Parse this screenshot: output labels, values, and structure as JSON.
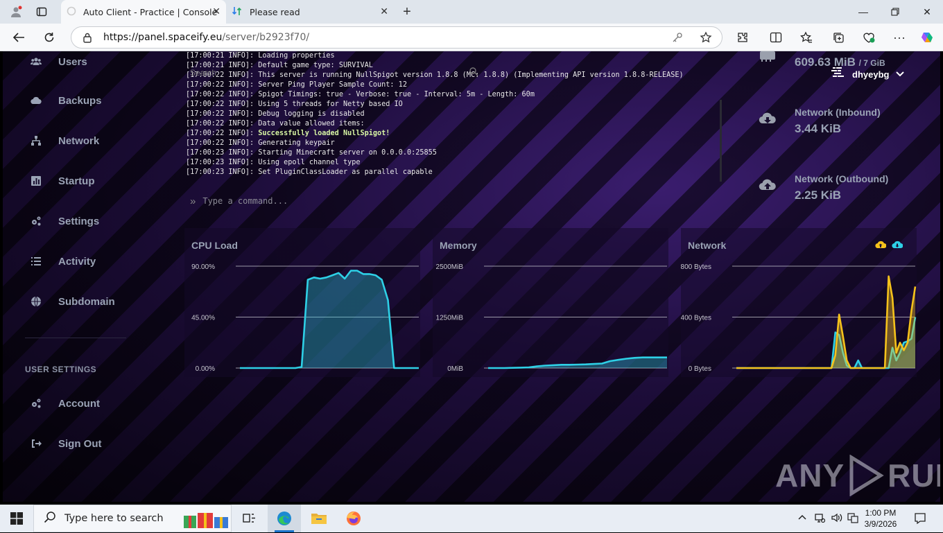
{
  "browser": {
    "tabs": [
      {
        "title": "Auto Client - Practice | Console",
        "active": true
      },
      {
        "title": "Please read",
        "active": false
      }
    ],
    "url_host": "https://panel.spaceify.eu",
    "url_path": "/server/b2923f70/"
  },
  "sidebar": {
    "items": [
      {
        "label": "Users",
        "icon": "users-icon"
      },
      {
        "label": "Backups",
        "icon": "cloud-icon"
      },
      {
        "label": "Network",
        "icon": "network-icon"
      },
      {
        "label": "Startup",
        "icon": "chart-icon"
      },
      {
        "label": "Settings",
        "icon": "gears-icon"
      },
      {
        "label": "Activity",
        "icon": "list-icon"
      },
      {
        "label": "Subdomain",
        "icon": "globe-icon"
      }
    ],
    "user_settings_heading": "USER SETTINGS",
    "user_items": [
      {
        "label": "Account",
        "icon": "gears-icon"
      },
      {
        "label": "Sign Out",
        "icon": "sign-out-icon"
      }
    ]
  },
  "console": {
    "search_overlay": "Search",
    "lines": [
      {
        "prefix": "[17:00:21 INFO]: ",
        "msg": "Loading properties"
      },
      {
        "prefix": "[17:00:21 INFO]: ",
        "msg": "Default game type: SURVIVAL"
      },
      {
        "prefix": "[17:00:22 INFO]: ",
        "msg": "This server is running NullSpigot version 1.8.8 (MC: 1.8.8) (Implementing API version 1.8.8-RELEASE)"
      },
      {
        "prefix": "[17:00:22 INFO]: ",
        "msg": "Server Ping Player Sample Count: 12"
      },
      {
        "prefix": "[17:00:22 INFO]: ",
        "msg": "Spigot Timings: true - Verbose: true - Interval: 5m - Length: 60m"
      },
      {
        "prefix": "[17:00:22 INFO]: ",
        "msg": "Using 5 threads for Netty based IO"
      },
      {
        "prefix": "[17:00:22 INFO]: ",
        "msg": "Debug logging is disabled"
      },
      {
        "prefix": "[17:00:22 INFO]: ",
        "msg": "Data value allowed items:"
      },
      {
        "prefix": "[17:00:22 INFO]: ",
        "msg": "Successfully loaded NullSpigot!",
        "success": true
      },
      {
        "prefix": "[17:00:22 INFO]: ",
        "msg": "Generating keypair"
      },
      {
        "prefix": "[17:00:23 INFO]: ",
        "msg": "Starting Minecraft server on 0.0.0.0:25855"
      },
      {
        "prefix": "[17:00:23 INFO]: ",
        "msg": "Using epoll channel type"
      },
      {
        "prefix": "[17:00:23 INFO]: ",
        "msg": "Set PluginClassLoader as parallel capable"
      }
    ],
    "command_placeholder": "Type a command..."
  },
  "stats": {
    "memory_value": "609.63 MiB",
    "memory_limit": "/ 7 GiB",
    "network_inbound_label": "Network (Inbound)",
    "network_inbound_value": "3.44 KiB",
    "network_outbound_label": "Network (Outbound)",
    "network_outbound_value": "2.25 KiB"
  },
  "user_menu": {
    "username": "dhyeybg"
  },
  "colors": {
    "cyan": "#2ed0e6",
    "yellow": "#f5c21b",
    "muted_text": "#9aa3b5"
  },
  "chart_data": [
    {
      "type": "area",
      "title": "CPU Load",
      "y_ticks": [
        "90.00%",
        "45.00%",
        "0.00%"
      ],
      "ylim": [
        0,
        90
      ],
      "series": [
        {
          "color": "#2ed0e6",
          "values": [
            0,
            0,
            0,
            0,
            0,
            0,
            0,
            0,
            0,
            0,
            1,
            78,
            80,
            79,
            80,
            82,
            84,
            79,
            86,
            86,
            83,
            83,
            82,
            78,
            60,
            0,
            0,
            0,
            0,
            0
          ]
        }
      ]
    },
    {
      "type": "area",
      "title": "Memory",
      "y_ticks": [
        "2500MiB",
        "1250MiB",
        "0MiB"
      ],
      "ylim": [
        0,
        2500
      ],
      "series": [
        {
          "color": "#2ed0e6",
          "values": [
            0,
            0,
            0,
            5,
            10,
            15,
            40,
            60,
            70,
            80,
            80,
            85,
            90,
            100,
            110,
            170,
            200,
            230,
            250,
            260,
            260,
            260,
            260
          ]
        }
      ]
    },
    {
      "type": "area",
      "title": "Network",
      "y_ticks": [
        "800 Bytes",
        "400 Bytes",
        "0 Bytes"
      ],
      "ylim": [
        0,
        800
      ],
      "series": [
        {
          "name": "inbound",
          "color": "#2ed0e6",
          "values": [
            0,
            0,
            0,
            0,
            0,
            0,
            0,
            0,
            0,
            0,
            0,
            0,
            0,
            0,
            0,
            0,
            0,
            0,
            0,
            0,
            0,
            0,
            0,
            0,
            0,
            0,
            280,
            260,
            120,
            20,
            0,
            0,
            60,
            0,
            0,
            0,
            0,
            0,
            0,
            0,
            0,
            160,
            60,
            120,
            200,
            210,
            230,
            400
          ]
        },
        {
          "name": "outbound",
          "color": "#f5c21b",
          "values": [
            0,
            0,
            0,
            0,
            0,
            0,
            0,
            0,
            0,
            0,
            0,
            0,
            0,
            0,
            0,
            0,
            0,
            0,
            0,
            0,
            0,
            0,
            0,
            0,
            0,
            0,
            100,
            420,
            250,
            60,
            0,
            0,
            0,
            0,
            0,
            0,
            0,
            0,
            0,
            0,
            720,
            550,
            120,
            200,
            140,
            200,
            450,
            640
          ]
        }
      ]
    }
  ],
  "watermark": {
    "left": "ANY",
    "right": "RUN"
  },
  "taskbar": {
    "search_placeholder": "Type here to search",
    "time": "1:00 PM",
    "date": "3/9/2026"
  }
}
